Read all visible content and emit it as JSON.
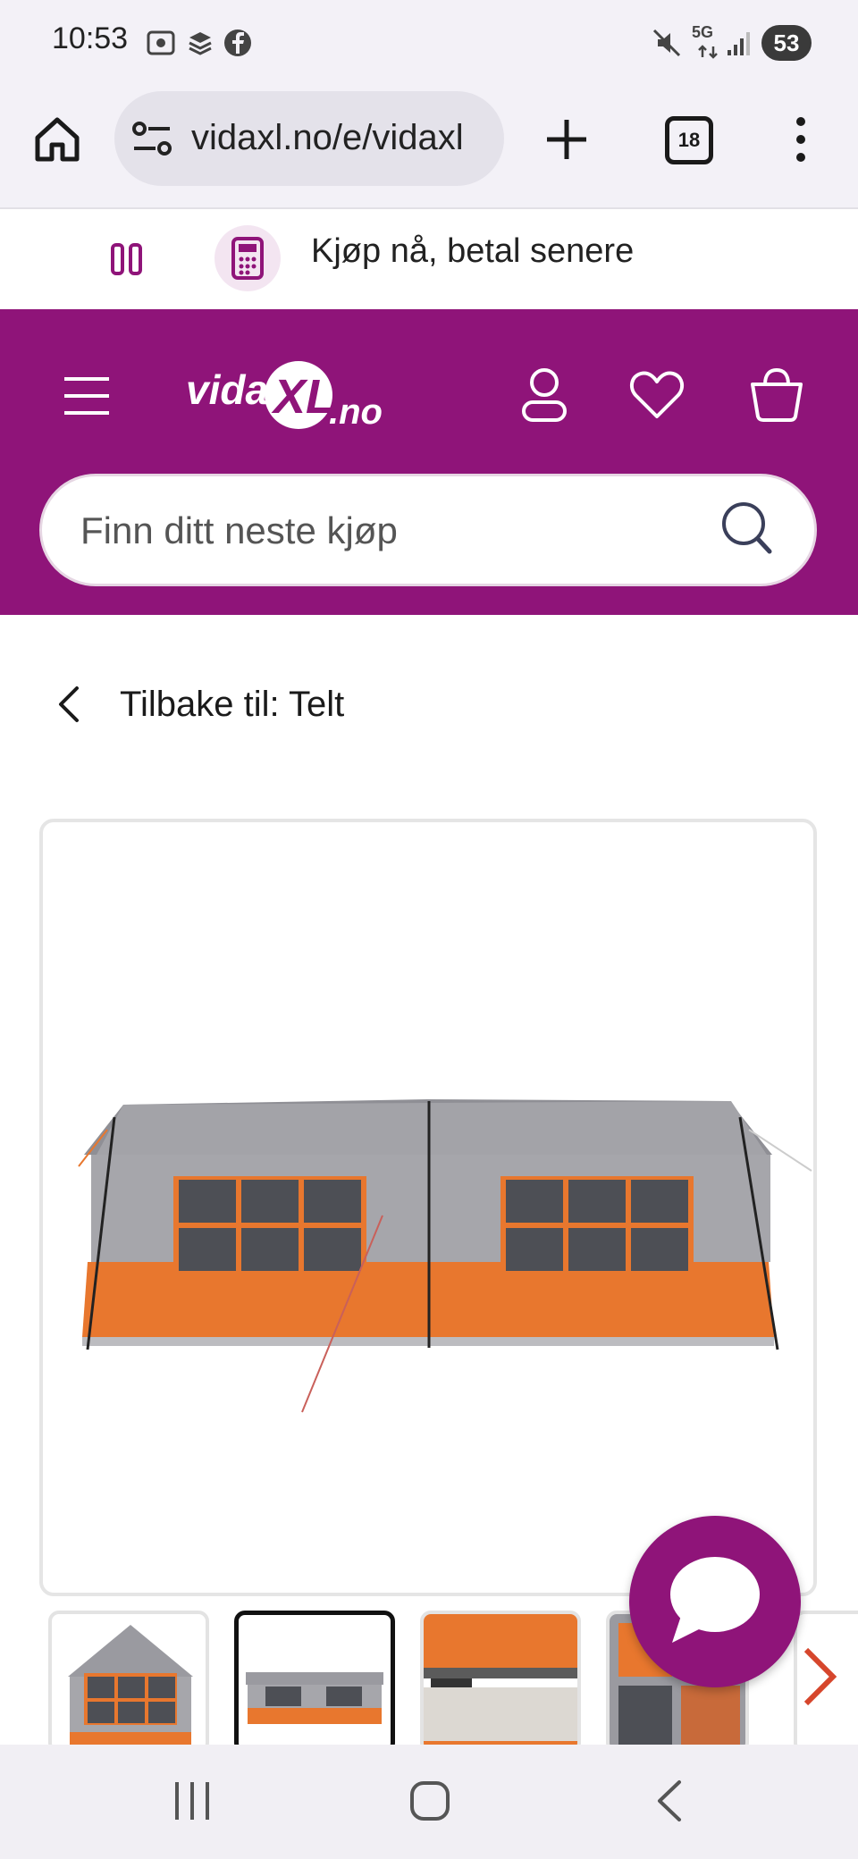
{
  "status_bar": {
    "time": "10:53",
    "network": "5G",
    "battery": "53",
    "icons": [
      "screenshot-icon",
      "layers-icon",
      "facebook-icon",
      "mute-icon",
      "5g-icon",
      "signal-icon"
    ]
  },
  "browser": {
    "url": "vidaxl.no/e/vidaxl",
    "tab_count": "18",
    "icons": [
      "home-icon",
      "site-settings-icon",
      "new-tab-icon",
      "tabs-icon",
      "more-icon"
    ]
  },
  "promo": {
    "text": "Kjøp nå, betal senere",
    "icon": "calculator-icon"
  },
  "header": {
    "logo_text": "vidaXL.no",
    "brand_color": "#8f1479",
    "icons": [
      "menu-icon",
      "account-icon",
      "wishlist-icon",
      "cart-icon"
    ]
  },
  "search": {
    "placeholder": "Finn ditt neste kjøp"
  },
  "breadcrumb": {
    "back_label": "Tilbake til: Telt"
  },
  "product": {
    "image": "tent-image",
    "thumbnails": [
      "tent-front-thumbnail",
      "tent-side-thumbnail",
      "fabric-detail-thumbnail",
      "features-thumbnail"
    ],
    "accent_color": "#e8772e"
  },
  "chat": {
    "icon": "chat-bubble-icon"
  },
  "nav": {
    "icons": [
      "recent-apps-icon",
      "home-nav-icon",
      "back-nav-icon"
    ]
  }
}
